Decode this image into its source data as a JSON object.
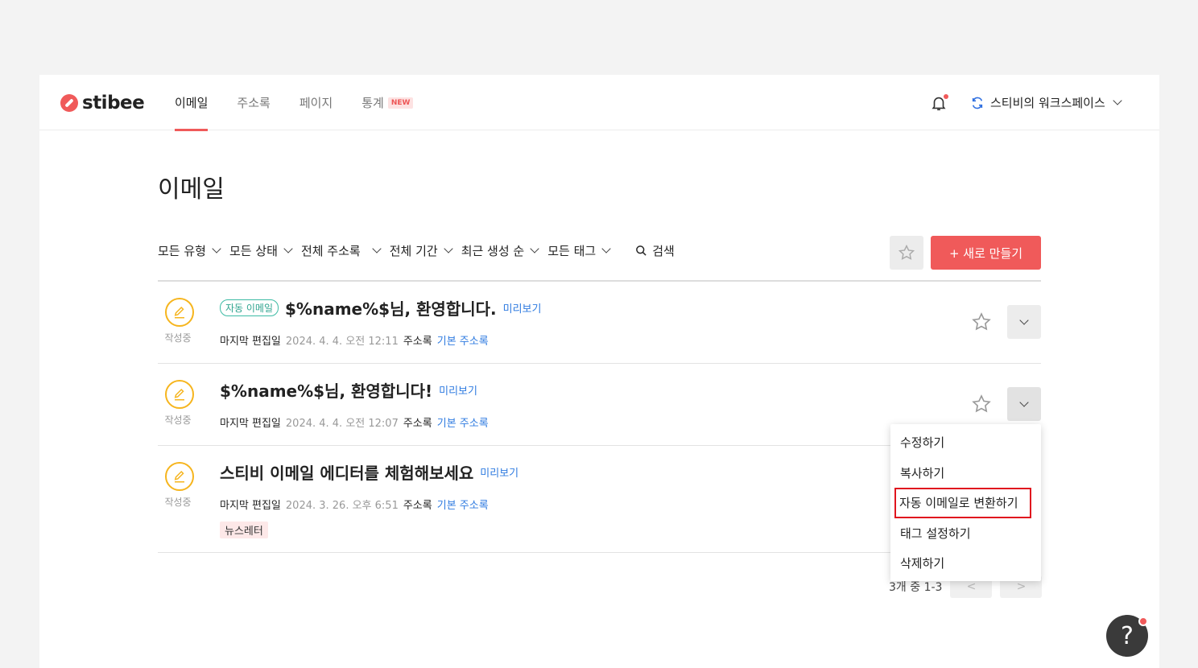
{
  "app": {
    "logo": "stibee",
    "workspace": "스티비의 워크스페이스"
  },
  "nav": [
    {
      "label": "이메일",
      "active": true
    },
    {
      "label": "주소록"
    },
    {
      "label": "페이지"
    },
    {
      "label": "통계",
      "badge": "NEW"
    }
  ],
  "page": {
    "title": "이메일"
  },
  "filters": [
    "모든 유형",
    "모든 상태",
    "전체 주소록",
    "전체 기간",
    "최근 생성 순",
    "모든 태그"
  ],
  "search": {
    "label": "검색"
  },
  "new_button": "+ 새로 만들기",
  "emails": [
    {
      "status": "작성중",
      "type_tag": "자동 이메일",
      "title": "$%name%$님, 환영합니다.",
      "preview": "미리보기",
      "meta_label": "마지막 편집일",
      "edited": "2024. 4. 4. 오전 12:11",
      "list_label": "주소록",
      "list": "기본 주소록"
    },
    {
      "status": "작성중",
      "title": "$%name%$님, 환영합니다!",
      "preview": "미리보기",
      "meta_label": "마지막 편집일",
      "edited": "2024. 4. 4. 오전 12:07",
      "list_label": "주소록",
      "list": "기본 주소록"
    },
    {
      "status": "작성중",
      "title": "스티비 이메일 에디터를 체험해보세요",
      "preview": "미리보기",
      "meta_label": "마지막 편집일",
      "edited": "2024. 3. 26. 오후 6:51",
      "list_label": "주소록",
      "list": "기본 주소록",
      "tag": "뉴스레터"
    }
  ],
  "menu": [
    "수정하기",
    "복사하기",
    "자동 이메일로 변환하기",
    "태그 설정하기",
    "삭제하기"
  ],
  "pagination": {
    "text": "3개 중 1-3",
    "prev": "<",
    "next": ">"
  },
  "help": "?",
  "colors": {
    "brand": "#f05a5a",
    "link": "#2f7be0",
    "status": "#f6b51e",
    "auto_tag": "#3cbba4",
    "highlight": "#e0141e"
  }
}
